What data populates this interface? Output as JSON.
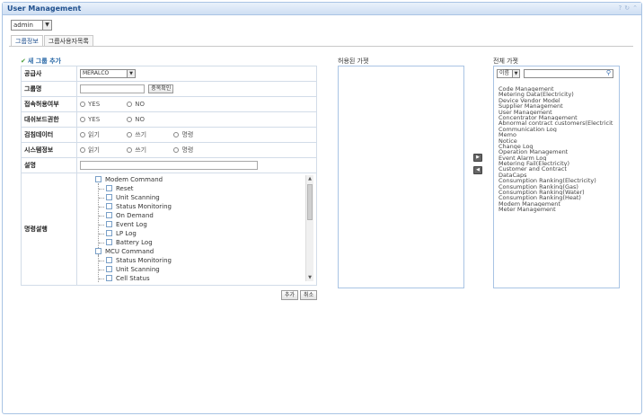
{
  "window": {
    "title": "User Management",
    "tools": [
      "?",
      "↻",
      "⌃"
    ]
  },
  "user_select": {
    "value": "admin"
  },
  "tabs": [
    {
      "label": "그룹정보"
    },
    {
      "label": "그룹사용자목록"
    }
  ],
  "form": {
    "title": "새 그룹 추가",
    "supplier": {
      "label": "공급사",
      "value": "MERALCO"
    },
    "group_name": {
      "label": "그룹명",
      "check_button": "중복확인"
    },
    "access": {
      "label": "접속허용여부",
      "options": [
        "YES",
        "NO"
      ]
    },
    "dashboard": {
      "label": "대쉬보드권한",
      "options": [
        "YES",
        "NO"
      ]
    },
    "metering": {
      "label": "검침데이터",
      "options": [
        "읽기",
        "쓰기",
        "명령"
      ]
    },
    "system": {
      "label": "시스템정보",
      "options": [
        "읽기",
        "쓰기",
        "명령"
      ]
    },
    "description": {
      "label": "설명"
    },
    "commands": {
      "label": "명령설행",
      "tree": [
        {
          "label": "Modem Command",
          "level": 0
        },
        {
          "label": "Reset",
          "level": 1
        },
        {
          "label": "Unit Scanning",
          "level": 1
        },
        {
          "label": "Status Monitoring",
          "level": 1
        },
        {
          "label": "On Demand",
          "level": 1
        },
        {
          "label": "Event Log",
          "level": 1
        },
        {
          "label": "LP Log",
          "level": 1
        },
        {
          "label": "Battery Log",
          "level": 1
        },
        {
          "label": "MCU Command",
          "level": 0
        },
        {
          "label": "Status Monitoring",
          "level": 1
        },
        {
          "label": "Unit Scanning",
          "level": 1
        },
        {
          "label": "Cell Status",
          "level": 1
        }
      ]
    },
    "add_button": "추가",
    "cancel_button": "취소"
  },
  "allowed_gadgets": {
    "label": "허용된 가젯"
  },
  "all_gadgets": {
    "label": "전체 가젯",
    "filter_value": "이름",
    "items": [
      "Code Management",
      "Metering Data(Electricity)",
      "Device Vendor Model",
      "Supplier Management",
      "User Management",
      "Concentrator Management",
      "Abnormal contract customers(Electricit",
      "Communication Log",
      "Memo",
      "Notice",
      "Change Log",
      "Operation Management",
      "Event Alarm Log",
      "Metering Fail(Electricity)",
      "Customer and Contract",
      "DataCaps",
      "Consumption Ranking(Electricity)",
      "Consumption Ranking(Gas)",
      "Consumption Ranking(Water)",
      "Consumption Ranking(Heat)",
      "Modem Management",
      "Meter Management"
    ]
  },
  "move_buttons": {
    "add": "▶",
    "remove": "◀"
  }
}
